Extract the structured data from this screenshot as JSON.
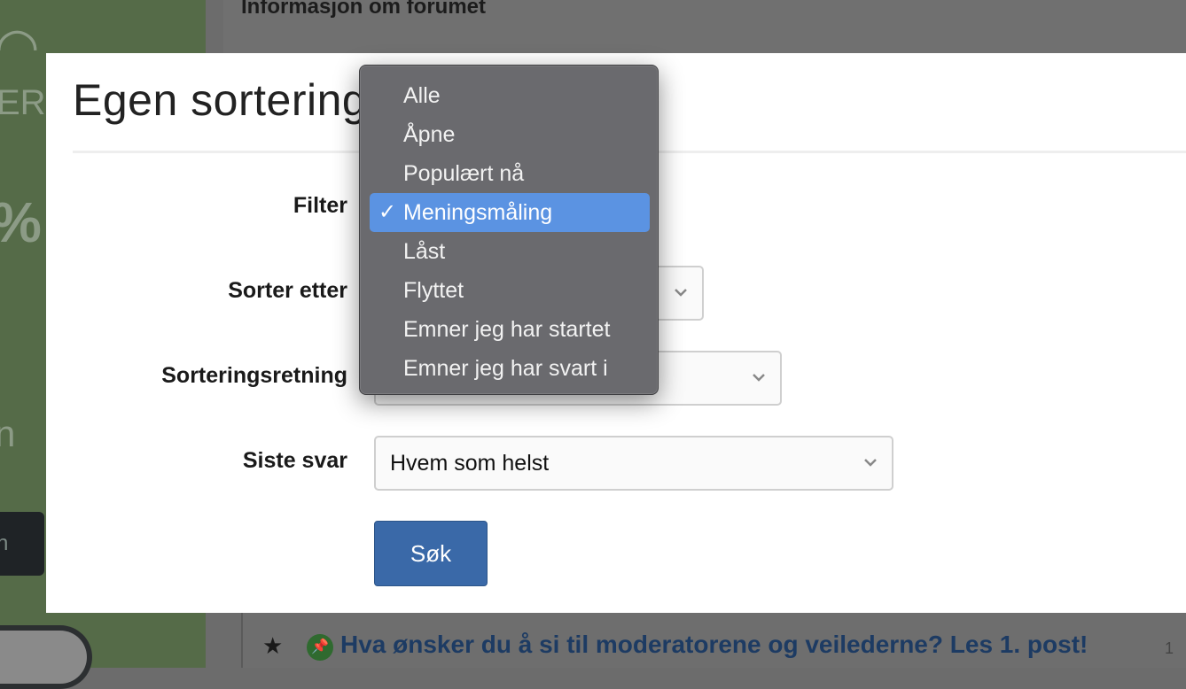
{
  "background": {
    "header_title": "Informasjon om forumet",
    "left_fragments": [
      "ER",
      "%",
      "n",
      "n"
    ],
    "thread_title": "Hva ønsker du å si til moderatorene og veilederne? Les 1. post!",
    "thread_count": "1"
  },
  "modal": {
    "title": "Egen sortering",
    "fields": {
      "filter_label": "Filter",
      "sort_by_label": "Sorter etter",
      "sort_direction_label": "Sorteringsretning",
      "last_reply_label": "Siste svar",
      "last_reply_value": "Hvem som helst"
    },
    "search_button": "Søk"
  },
  "dropdown": {
    "options": [
      {
        "label": "Alle",
        "selected": false
      },
      {
        "label": "Åpne",
        "selected": false
      },
      {
        "label": "Populært nå",
        "selected": false
      },
      {
        "label": "Meningsmåling",
        "selected": true
      },
      {
        "label": "Låst",
        "selected": false
      },
      {
        "label": "Flyttet",
        "selected": false
      },
      {
        "label": "Emner jeg har startet",
        "selected": false
      },
      {
        "label": "Emner jeg har svart i",
        "selected": false
      }
    ],
    "check_mark": "✓",
    "selected_color": "#5b93e2"
  },
  "colors": {
    "primary_button": "#3a69a8",
    "sidebar_bg": "#556b48",
    "link": "#1d3b63"
  }
}
